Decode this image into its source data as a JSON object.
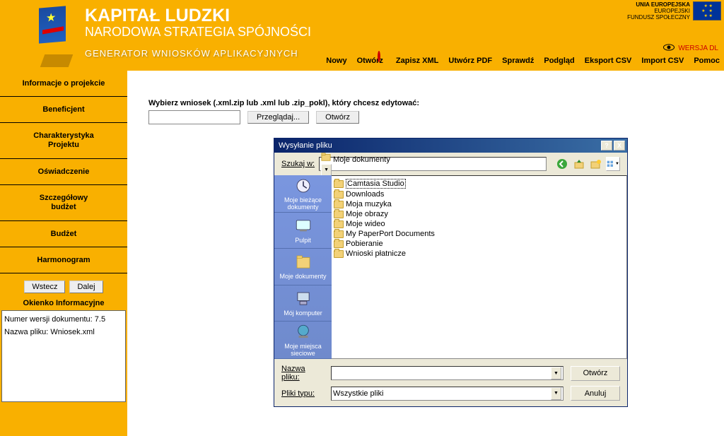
{
  "header": {
    "title": "KAPITAŁ LUDZKI",
    "subtitle": "NARODOWA STRATEGIA SPÓJNOŚCI",
    "generator": "GENERATOR WNIOSKÓW APLIKACYJNYCH",
    "eu_line1": "UNIA EUROPEJSKA",
    "eu_line2": "EUROPEJSKI",
    "eu_line3": "FUNDUSZ SPOŁECZNY",
    "wersja": "WERSJA DL"
  },
  "topnav": {
    "nowy": "Nowy",
    "otworz": "Otwórz",
    "zapisz": "Zapisz XML",
    "utworz": "Utwórz PDF",
    "sprawdz": "Sprawdź",
    "podglad": "Podgląd",
    "eksport": "Eksport CSV",
    "import": "Import CSV",
    "pomoc": "Pomoc"
  },
  "sidebar": {
    "items": [
      "Informacje o projekcie",
      "Beneficjent",
      "Charakterystyka\nProjektu",
      "Oświadczenie",
      "Szczegółowy\nbudżet",
      "Budżet",
      "Harmonogram"
    ],
    "wstecz": "Wstecz",
    "dalej": "Dalej",
    "info_title": "Okienko Informacyjne",
    "info_line1": "Numer wersji dokumentu: 7.5",
    "info_line2": "Nazwa pliku: Wniosek.xml"
  },
  "main": {
    "prompt": "Wybierz wniosek (.xml.zip lub .xml lub .zip_pokl), który chcesz edytować:",
    "browse": "Przeglądaj...",
    "open": "Otwórz"
  },
  "dialog": {
    "title": "Wysyłanie pliku",
    "help": "?",
    "close": "X",
    "lookin_label": "Szukaj w:",
    "lookin_value": "Moje dokumenty",
    "places": {
      "recent": "Moje bieżące dokumenty",
      "desktop": "Pulpit",
      "mydocs": "Moje dokumenty",
      "mycomp": "Mój komputer",
      "network": "Moje miejsca sieciowe"
    },
    "folders": [
      "Camtasia Studio",
      "Downloads",
      "Moja muzyka",
      "Moje obrazy",
      "Moje wideo",
      "My PaperPort Documents",
      "Pobieranie",
      "Wnioski płatnicze"
    ],
    "filename_label": "Nazwa pliku:",
    "filename_value": "",
    "filetype_label": "Pliki typu:",
    "filetype_value": "Wszystkie pliki",
    "open_btn": "Otwórz",
    "cancel_btn": "Anuluj"
  }
}
